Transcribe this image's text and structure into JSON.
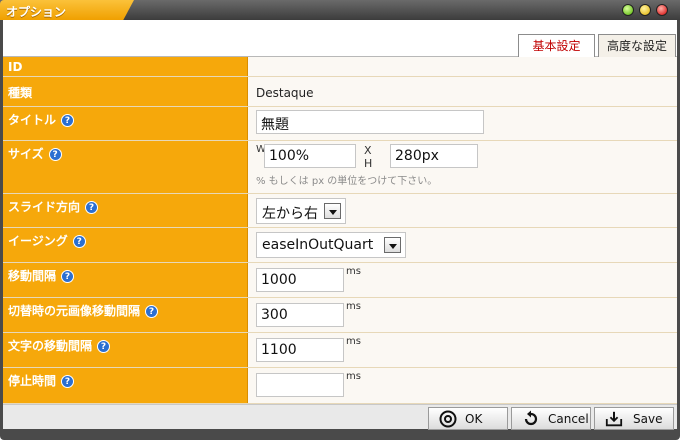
{
  "window": {
    "title": "オプション"
  },
  "tabs": [
    {
      "label": "基本設定",
      "active": true
    },
    {
      "label": "高度な設定",
      "active": false
    }
  ],
  "fields": {
    "id": {
      "label": "ID"
    },
    "type": {
      "label": "種類",
      "value": "Destaque"
    },
    "title": {
      "label": "タイトル",
      "value": "無題"
    },
    "size": {
      "label": "サイズ",
      "w_label": "W",
      "h_label": "X H",
      "width": "100%",
      "height": "280px",
      "hint": "% もしくは px の単位をつけて下さい。"
    },
    "slide_direction": {
      "label": "スライド方向",
      "value": "左から右"
    },
    "easing": {
      "label": "イージング",
      "value": "easeInOutQuart"
    },
    "move_interval": {
      "label": "移動間隔",
      "value": "1000",
      "unit": "ms"
    },
    "switch_interval": {
      "label": "切替時の元画像移動間隔",
      "value": "300",
      "unit": "ms"
    },
    "text_interval": {
      "label": "文字の移動間隔",
      "value": "1100",
      "unit": "ms"
    },
    "pause_time": {
      "label": "停止時間",
      "value": "",
      "unit": "ms"
    }
  },
  "footer": {
    "ok_label": "OK",
    "cancel_label": "Cancel",
    "save_label": "Save"
  },
  "colors": {
    "accent": "#f6a80b",
    "active_tab_text": "#c00000",
    "help": "#2b6fd1"
  }
}
